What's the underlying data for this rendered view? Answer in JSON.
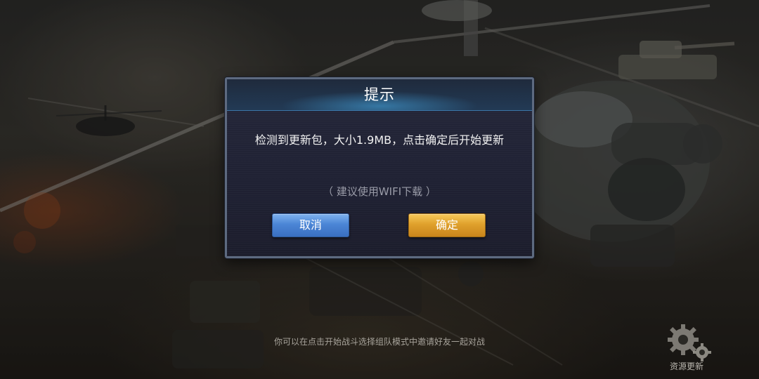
{
  "dialog": {
    "title": "提示",
    "message": "检测到更新包，大小1.9MB，点击确定后开始更新",
    "hint": "（ 建议使用WIFI下载 ）",
    "cancel_label": "取消",
    "confirm_label": "确定"
  },
  "footer": {
    "tip": "你可以在点击开始战斗选择组队模式中邀请好友一起对战"
  },
  "resource_update": {
    "label": "资源更新",
    "icon": "gear-icon"
  },
  "colors": {
    "cancel_button": "#4b86d6",
    "confirm_button": "#e0a12c",
    "dialog_border": "#5d6a80",
    "header_glow": "#46aae6"
  }
}
